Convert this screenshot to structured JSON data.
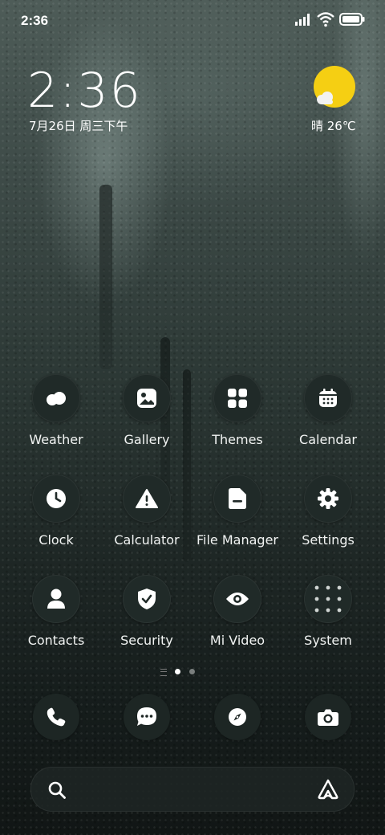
{
  "status_bar": {
    "time": "2:36"
  },
  "lock_widget": {
    "time": "2:36",
    "date": "7月26日 周三下午",
    "weather": "晴 26℃",
    "weather_icon": "sun-cloud-icon",
    "sun_color": "#F5CF13"
  },
  "apps": [
    {
      "label": "Weather",
      "icon": "cloud-icon"
    },
    {
      "label": "Gallery",
      "icon": "image-icon"
    },
    {
      "label": "Themes",
      "icon": "grid-icon"
    },
    {
      "label": "Calendar",
      "icon": "calendar-icon"
    },
    {
      "label": "Clock",
      "icon": "clock-icon"
    },
    {
      "label": "Calculator",
      "icon": "warning-triangle-icon"
    },
    {
      "label": "File Manager",
      "icon": "folder-icon"
    },
    {
      "label": "Settings",
      "icon": "gear-icon"
    },
    {
      "label": "Contacts",
      "icon": "person-icon"
    },
    {
      "label": "Security",
      "icon": "shield-check-icon"
    },
    {
      "label": "Mi Video",
      "icon": "eye-icon"
    },
    {
      "label": "System",
      "icon": "folder-grid-icon"
    }
  ],
  "pager": {
    "current_page": 1,
    "pages": 2
  },
  "dock": [
    {
      "icon": "phone-icon"
    },
    {
      "icon": "message-icon"
    },
    {
      "icon": "compass-icon"
    },
    {
      "icon": "camera-icon"
    }
  ],
  "search": {
    "icon": "search-icon",
    "assistant_icon": "assistant-icon"
  }
}
